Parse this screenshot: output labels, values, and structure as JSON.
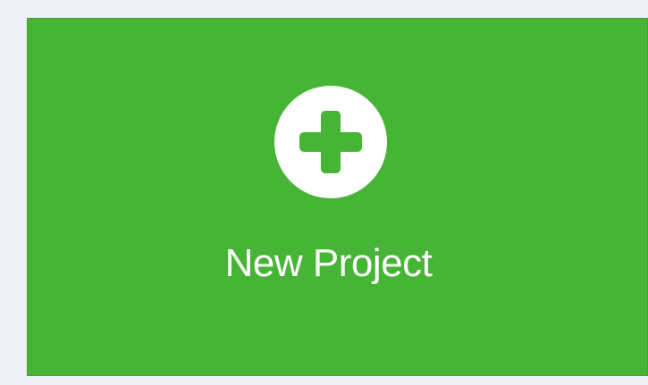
{
  "new_project_tile": {
    "label": "New Project",
    "icon": "plus-circle-icon",
    "background_color": "#46b535",
    "icon_color": "#ffffff"
  },
  "page": {
    "background_color": "#eef1f5"
  }
}
